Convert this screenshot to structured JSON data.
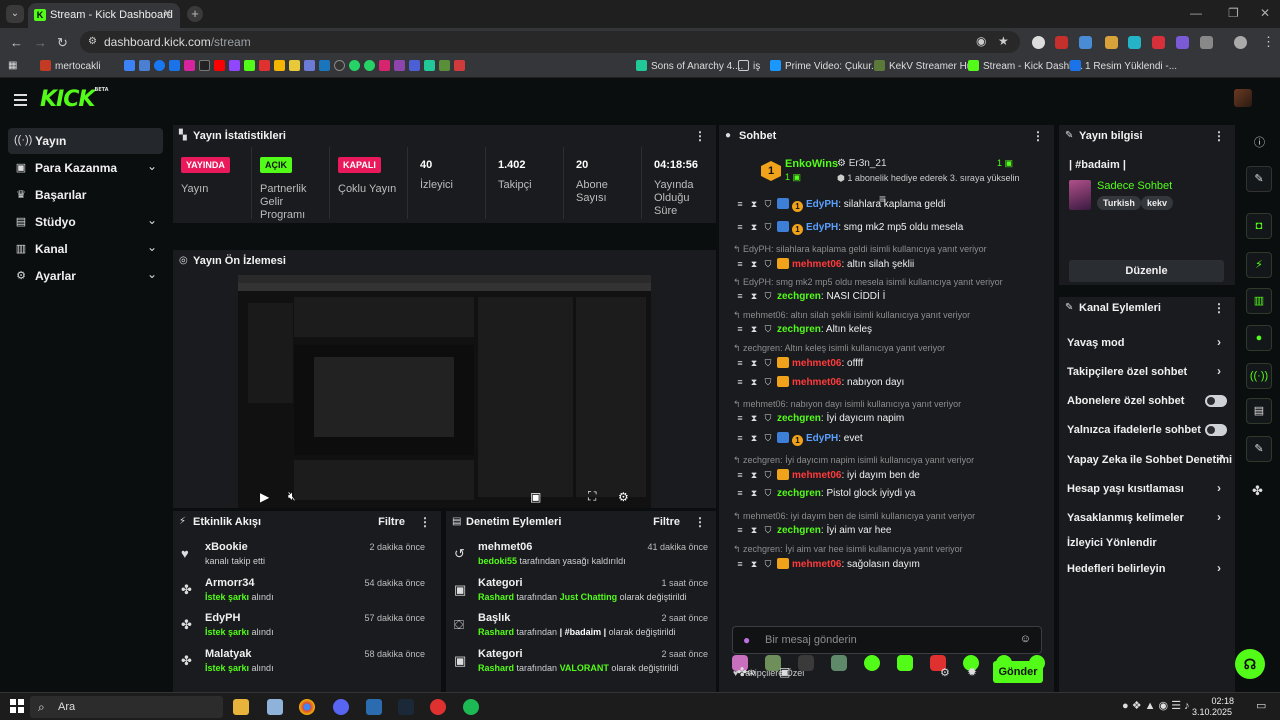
{
  "browser": {
    "tab_title": "Stream - Kick Dashboard",
    "url_host": "dashboard.kick.com",
    "url_path": "/stream",
    "bookmarks": [
      "mertocakli",
      "Sons of Anarchy 4....",
      "iş",
      "Prime Video: Çukur...",
      "KekV Streamer Hub",
      "Stream - Kick Dashb...",
      "1 Resim Yüklendi -..."
    ]
  },
  "brand": {
    "logo": "KICK",
    "logo_sup": "BETA",
    "accent": "#53fc18"
  },
  "sidebar": {
    "items": [
      {
        "label": "Yayın",
        "icon": "broadcast-icon"
      },
      {
        "label": "Para Kazanma",
        "icon": "money-icon"
      },
      {
        "label": "Başarılar",
        "icon": "trophy-icon"
      },
      {
        "label": "Stüdyo",
        "icon": "studio-icon"
      },
      {
        "label": "Kanal",
        "icon": "channel-icon"
      },
      {
        "label": "Ayarlar",
        "icon": "gear-icon"
      }
    ]
  },
  "stats": {
    "title": "Yayın İstatistikleri",
    "items": [
      {
        "badge": "YAYINDA",
        "label": "Yayın"
      },
      {
        "badge": "AÇIK",
        "label": "Partnerlik Gelir Programı"
      },
      {
        "badge": "KAPALI",
        "label": "Çoklu Yayın"
      },
      {
        "value": "40",
        "label": "İzleyici"
      },
      {
        "value": "1.402",
        "label": "Takipçi"
      },
      {
        "value": "20",
        "label": "Abone Sayısı"
      },
      {
        "value": "04:18:56",
        "label": "Yayında Olduğu Süre"
      }
    ]
  },
  "preview": {
    "title": "Yayın Ön İzlemesi"
  },
  "activity": {
    "title": "Etkinlik Akışı",
    "filter": "Filtre",
    "rows": [
      {
        "name": "xBookie",
        "sub_plain": "kanalı takip etti",
        "sub_hl": "",
        "time": "2 dakika önce"
      },
      {
        "name": "Armorr34",
        "sub_hl": "İstek şarkı",
        "sub_plain": " alındı",
        "time": "54 dakika önce"
      },
      {
        "name": "EdyPH",
        "sub_hl": "İstek şarkı",
        "sub_plain": " alındı",
        "time": "57 dakika önce"
      },
      {
        "name": "Malatyak",
        "sub_hl": "İstek şarkı",
        "sub_plain": " alındı",
        "time": "58 dakika önce"
      }
    ]
  },
  "moderation": {
    "title": "Denetim Eylemleri",
    "filter": "Filtre",
    "rows": [
      {
        "name": "mehmet06",
        "hl": "bedoki55",
        "rest": " tarafından yasağı kaldırıldı",
        "time": "41 dakika önce"
      },
      {
        "name": "Kategori",
        "hl": "Rashard",
        "rest": " tarafından ",
        "hl2": "Just Chatting",
        "rest2": " olarak değiştirildi",
        "time": "1 saat önce"
      },
      {
        "name": "Başlık",
        "hl": "Rashard",
        "rest": " tarafından ",
        "hl2": "| #badaim |",
        "rest2": " olarak değiştirildi",
        "time": "2 saat önce"
      },
      {
        "name": "Kategori",
        "hl": "Rashard",
        "rest": " tarafından ",
        "hl2": "VALORANT",
        "rest2": " olarak değiştirildi",
        "time": "2 saat önce"
      }
    ]
  },
  "chat": {
    "title": "Sohbet",
    "pinned": {
      "user": "EnkoWins",
      "count": "1",
      "gifter": "Er3n_21",
      "gift_count": "1",
      "note": "1 abonelik hediye ederek 3. sıraya yükselin"
    },
    "messages": [
      {
        "reply": "",
        "user": "EdyPH",
        "color": "#5aa0ff",
        "text": ": silahlara kaplama geldi"
      },
      {
        "reply": "",
        "user": "EdyPH",
        "color": "#5aa0ff",
        "text": ": smg mk2 mp5 oldu mesela"
      },
      {
        "reply": "EdyPH: silahlara kaplama geldi isimli kullanıcıya yanıt veriyor",
        "user": "mehmet06",
        "color": "#ff3b3b",
        "text": ": altın silah şeklii"
      },
      {
        "reply": "EdyPH: smg mk2 mp5 oldu mesela isimli kullanıcıya yanıt veriyor",
        "user": "zechgren",
        "color": "#53fc18",
        "text": ": NASI CİDDİ İ"
      },
      {
        "reply": "mehmet06: altın silah şeklii isimli kullanıcıya yanıt veriyor",
        "user": "zechgren",
        "color": "#53fc18",
        "text": ": Altın keleş"
      },
      {
        "reply": "zechgren: Altın keleş isimli kullanıcıya yanıt veriyor",
        "user": "mehmet06",
        "color": "#ff3b3b",
        "text": ": offff"
      },
      {
        "reply": "",
        "user": "mehmet06",
        "color": "#ff3b3b",
        "text": ": nabıyon dayı"
      },
      {
        "reply": "mehmet06: nabıyon dayı isimli kullanıcıya yanıt veriyor",
        "user": "zechgren",
        "color": "#53fc18",
        "text": ": İyi dayıcım napim"
      },
      {
        "reply": "",
        "user": "EdyPH",
        "color": "#5aa0ff",
        "text": ": evet"
      },
      {
        "reply": "zechgren: İyi dayıcım napim isimli kullanıcıya yanıt veriyor",
        "user": "mehmet06",
        "color": "#ff3b3b",
        "text": ": iyi dayım ben de"
      },
      {
        "reply": "",
        "user": "zechgren",
        "color": "#53fc18",
        "text": ": Pistol glock iyiydi ya"
      },
      {
        "reply": "mehmet06: iyi dayım ben de isimli kullanıcıya yanıt veriyor",
        "user": "zechgren",
        "color": "#53fc18",
        "text": ": İyi aim var hee"
      },
      {
        "reply": "zechgren: İyi aim var hee isimli kullanıcıya yanıt veriyor",
        "user": "mehmet06",
        "color": "#ff3b3b",
        "text": ": sağolasın dayım"
      }
    ],
    "followers_only_label": "Takipçilere Özel",
    "input_placeholder": "Bir mesaj gönderin",
    "send_label": "Gönder"
  },
  "stream_info": {
    "title": "Yayın bilgisi",
    "stream_title": "| #badaim |",
    "category": "Sadece Sohbet",
    "tags": [
      "Turkish",
      "kekv"
    ],
    "edit_label": "Düzenle"
  },
  "channel_actions": {
    "title": "Kanal Eylemleri",
    "items": [
      {
        "label": "Yavaş mod",
        "control": "arrow"
      },
      {
        "label": "Takipçilere özel sohbet",
        "control": "arrow"
      },
      {
        "label": "Abonelere özel sohbet",
        "control": "toggle"
      },
      {
        "label": "Yalnızca ifadelerle sohbet",
        "control": "toggle"
      },
      {
        "label": "Yapay Zeka ile Sohbet Denetimi",
        "control": "external"
      },
      {
        "label": "Hesap yaşı kısıtlaması",
        "control": "arrow"
      },
      {
        "label": "Yasaklanmış kelimeler",
        "control": "arrow"
      },
      {
        "label": "İzleyici Yönlendir",
        "control": "none"
      },
      {
        "label": "Hedefleri belirleyin",
        "control": "arrow"
      }
    ]
  },
  "taskbar": {
    "search": "Ara",
    "time": "02:18",
    "date": "3.10.2025"
  }
}
